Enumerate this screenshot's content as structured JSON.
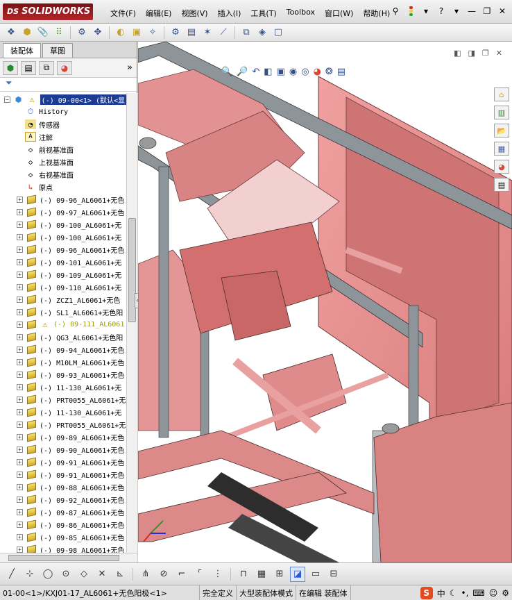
{
  "app": {
    "logo_text": "SOLIDWORKS",
    "logo_mark": "DS"
  },
  "menu": [
    "文件(F)",
    "编辑(E)",
    "视图(V)",
    "插入(I)",
    "工具(T)",
    "Toolbox",
    "窗口(W)",
    "帮助(H)"
  ],
  "window_controls": {
    "help": "?",
    "minimize": "—",
    "restore": "❐",
    "close": "✕",
    "dropdown": "▾"
  },
  "tabs": [
    "装配体",
    "草图"
  ],
  "tree": {
    "root": {
      "prefix": "(-)",
      "name": "09-00<1>",
      "suffix": "(默认<显"
    },
    "items": [
      {
        "label": "History",
        "icon": "history-icon"
      },
      {
        "label": "传感器",
        "icon": "sensor-icon"
      },
      {
        "label": "注解",
        "icon": "annotation-icon"
      },
      {
        "label": "前视基准面",
        "icon": "plane-icon"
      },
      {
        "label": "上视基准面",
        "icon": "plane-icon"
      },
      {
        "label": "右视基准面",
        "icon": "plane-icon"
      },
      {
        "label": "原点",
        "icon": "origin-icon"
      },
      {
        "label": "(-) 09-96_AL6061+无色",
        "icon": "part-icon"
      },
      {
        "label": "(-) 09-97_AL6061+无色",
        "icon": "part-icon"
      },
      {
        "label": "(-) 09-100_AL6061+无",
        "icon": "part-icon"
      },
      {
        "label": "(-) 09-100_AL6061+无",
        "icon": "part-icon"
      },
      {
        "label": "(-) 09-96_AL6061+无色",
        "icon": "part-icon"
      },
      {
        "label": "(-) 09-101_AL6061+无",
        "icon": "part-icon"
      },
      {
        "label": "(-) 09-109_AL6061+无",
        "icon": "part-icon"
      },
      {
        "label": "(-) 09-110_AL6061+无",
        "icon": "part-icon"
      },
      {
        "label": "(-) ZCZ1_AL6061+无色",
        "icon": "part-icon"
      },
      {
        "label": "(-) SL1_AL6061+无色阳",
        "icon": "part-icon"
      },
      {
        "label": "(-) 09-111_AL6061",
        "icon": "part-icon",
        "warning": true
      },
      {
        "label": "(-) QG3_AL6061+无色阳",
        "icon": "part-icon"
      },
      {
        "label": "(-) 09-94_AL6061+无色",
        "icon": "part-icon"
      },
      {
        "label": "(-) M10LM_AL6061+无色",
        "icon": "part-icon"
      },
      {
        "label": "(-) 09-93_AL6061+无色",
        "icon": "part-icon"
      },
      {
        "label": "(-) 11-130_AL6061+无",
        "icon": "part-icon"
      },
      {
        "label": "(-) PRT0055_AL6061+无",
        "icon": "part-icon"
      },
      {
        "label": "(-) 11-130_AL6061+无",
        "icon": "part-icon"
      },
      {
        "label": "(-) PRT0055_AL6061+无",
        "icon": "part-icon"
      },
      {
        "label": "(-) 09-89_AL6061+无色",
        "icon": "part-icon"
      },
      {
        "label": "(-) 09-90_AL6061+无色",
        "icon": "part-icon"
      },
      {
        "label": "(-) 09-91_AL6061+无色",
        "icon": "part-icon"
      },
      {
        "label": "(-) 09-91_AL6061+无色",
        "icon": "part-icon"
      },
      {
        "label": "(-) 09-88_AL6061+无色",
        "icon": "part-icon"
      },
      {
        "label": "(-) 09-92_AL6061+无色",
        "icon": "part-icon"
      },
      {
        "label": "(-) 09-87_AL6061+无色",
        "icon": "part-icon"
      },
      {
        "label": "(-) 09-86_AL6061+无色",
        "icon": "part-icon"
      },
      {
        "label": "(-) 09-85_AL6061+无色",
        "icon": "part-icon"
      },
      {
        "label": "(-) 09-98_AL6061+无色",
        "icon": "part-icon"
      }
    ]
  },
  "status": {
    "path": "01-00<1>/KXJ01-17_AL6061+无色阳极<1>",
    "definition": "完全定义",
    "mode": "大型装配体模式",
    "editing": "在编辑 装配体"
  },
  "ime": {
    "logo": "S",
    "lang": "中"
  },
  "colors": {
    "model": "#e68a8a",
    "frame": "#7e8a92",
    "accent": "#1c3c94"
  }
}
